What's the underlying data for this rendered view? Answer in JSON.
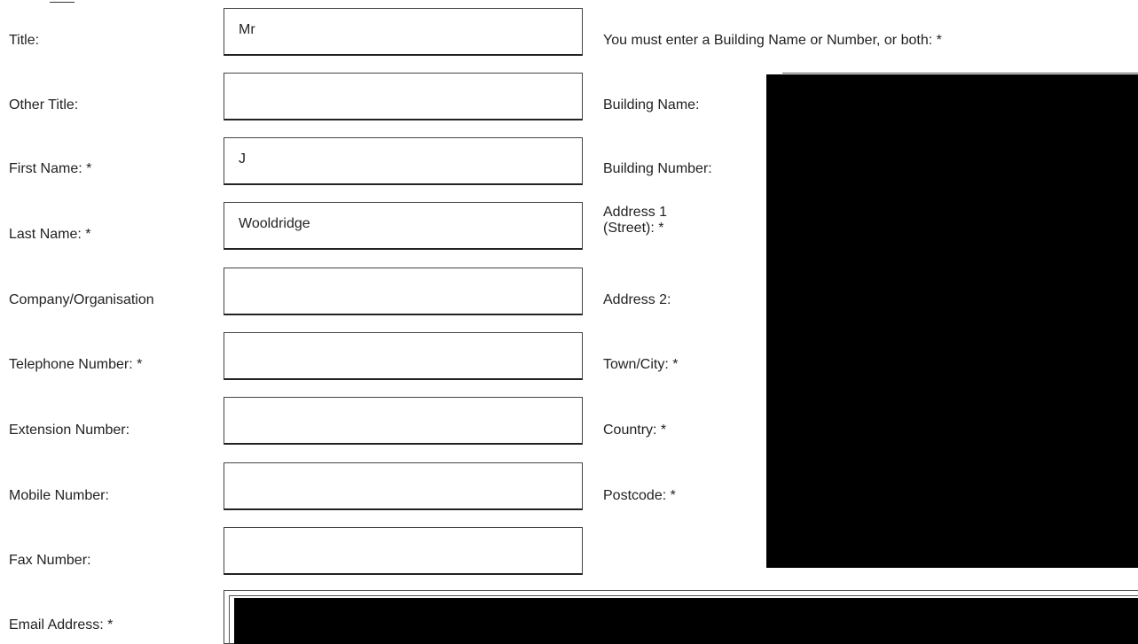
{
  "form": {
    "left_fields": [
      {
        "key": "title",
        "label": "Title:",
        "value": ""
      },
      {
        "key": "other_title",
        "label": "Other Title:",
        "value": ""
      },
      {
        "key": "first_name",
        "label": "First Name: *",
        "value": ""
      },
      {
        "key": "last_name",
        "label": "Last Name: *",
        "value": ""
      },
      {
        "key": "company",
        "label": "Company/Organisation",
        "value": ""
      },
      {
        "key": "telephone",
        "label": "Telephone Number: *",
        "value": ""
      },
      {
        "key": "extension",
        "label": "Extension Number:",
        "value": ""
      },
      {
        "key": "mobile",
        "label": "Mobile Number:",
        "value": ""
      },
      {
        "key": "fax",
        "label": "Fax Number:",
        "value": ""
      }
    ],
    "values": {
      "title": "Mr",
      "other_title": "",
      "first_name": "J",
      "last_name": "Wooldridge",
      "company": "",
      "telephone": "",
      "extension": "",
      "mobile": "",
      "fax": ""
    },
    "labels": {
      "title": "Title:",
      "other_title": "Other Title:",
      "first_name": "First Name: *",
      "last_name": "Last Name: *",
      "company": "Company/Organisation",
      "telephone": "Telephone Number: *",
      "extension": "Extension Number:",
      "mobile": "Mobile Number:",
      "fax": "Fax Number:",
      "email": "Email Address: *"
    },
    "address": {
      "instruction": "You must enter a Building Name or Number, or both: *",
      "building_name_label": "Building Name:",
      "building_number_label": "Building Number:",
      "address1_label_line1": "Address 1",
      "address1_label_line2": "(Street): *",
      "address2_label": "Address 2:",
      "town_label": "Town/City: *",
      "country_label": "Country: *",
      "postcode_label": "Postcode: *"
    },
    "redaction_color": "#000000"
  }
}
